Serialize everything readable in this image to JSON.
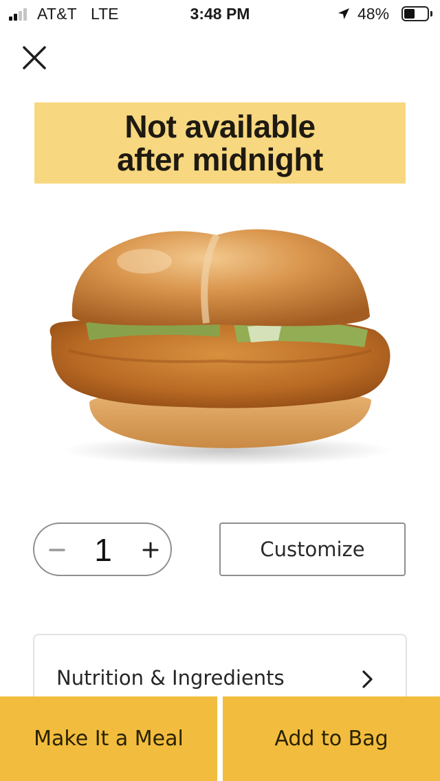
{
  "status_bar": {
    "carrier": "AT&T",
    "network": "LTE",
    "time": "3:48 PM",
    "battery_percent_label": "48%",
    "battery_level": 0.48
  },
  "icons": {
    "close": "close-icon",
    "minus": "minus-icon",
    "plus": "plus-icon",
    "chevron": "chevron-right-icon",
    "location": "location-arrow-icon"
  },
  "banner": {
    "line1": "Not available",
    "line2": "after midnight"
  },
  "product": {
    "image": "crispy-chicken-sandwich"
  },
  "quantity": {
    "value": "1"
  },
  "actions": {
    "customize_label": "Customize",
    "nutrition_label": "Nutrition & Ingredients",
    "meal_label": "Make It a Meal",
    "bag_label": "Add to Bag"
  },
  "colors": {
    "banner": "#f7d77f",
    "button_yellow": "#f2bd3e"
  }
}
